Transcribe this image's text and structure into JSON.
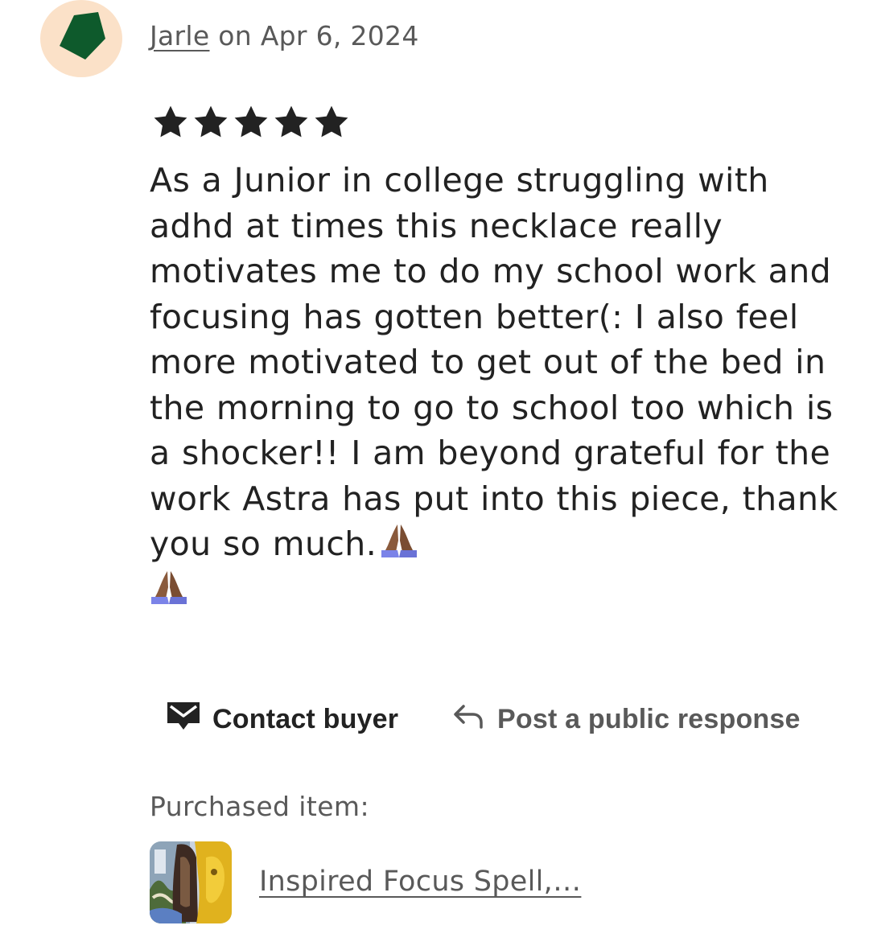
{
  "review": {
    "author": "Jarle",
    "date_prefix": "on",
    "date": "Apr 6, 2024",
    "rating": 5,
    "rating_max": 5,
    "text": "As a Junior in college struggling with adhd at times this necklace really motivates me to do my school work and focusing has gotten better(: I also feel more motivated to get out of the bed in the morning to go to school too which is a shocker!! I am beyond grateful for the work Astra has put into this piece, thank you so much."
  },
  "avatar": {
    "icon": "pentagon-avatar-icon",
    "background": "#fbe1c8",
    "shape_color": "#0e5a2c"
  },
  "actions": {
    "contact_label": "Contact buyer",
    "contact_icon": "envelope-icon",
    "respond_label": "Post a public response",
    "respond_icon": "reply-arrow-icon"
  },
  "purchase": {
    "label": "Purchased item:",
    "item_title": "Inspired Focus Spell,…",
    "thumbnail_icon": "product-thumbnail"
  },
  "colors": {
    "text_primary": "#222222",
    "text_secondary": "#595959",
    "emoji_skin": "#8a5a3c",
    "emoji_sleeve": "#7b83e8"
  }
}
